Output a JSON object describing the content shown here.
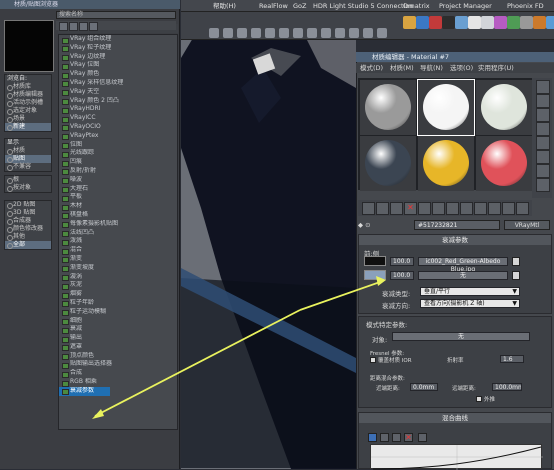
{
  "browser": {
    "title": "材质/贴图浏览器",
    "search_placeholder": "搜索名称",
    "maplist_header": "- 贴图",
    "groups": [
      {
        "title": "浏览自:",
        "items": [
          "材质库",
          "材质编辑器",
          "活动示例槽",
          "选定对象",
          "场景",
          "新建"
        ],
        "selected": 5
      },
      {
        "title": "显示",
        "items": [
          "材质",
          "贴图",
          "不兼容"
        ],
        "selected": 1
      },
      {
        "title": "",
        "items": [
          "根",
          "按对象"
        ],
        "selected": -1
      },
      {
        "title": "",
        "items": [
          "2D 贴图",
          "3D 贴图",
          "合成器",
          "颜色修改器",
          "其他",
          "全部"
        ],
        "selected": 5
      }
    ],
    "maps": [
      "VRay 组合纹理",
      "VRay 粒子纹理",
      "VRay 边纹理",
      "VRay 位图",
      "VRay 颜色",
      "VRay 采样信息纹理",
      "VRay 天空",
      "VRay 颜色 2 凹凸",
      "VRayHDRI",
      "VRayICC",
      "VRayOCIO",
      "VRayPtex",
      "位图",
      "光线跟踪",
      "凹痕",
      "反射/折射",
      "噪波",
      "大理石",
      "平板",
      "木材",
      "棋盘格",
      "每像素摄影机贴图",
      "法线凹凸",
      "泼溅",
      "混合",
      "渐变",
      "渐变坡度",
      "漩涡",
      "灰泥",
      "烟雾",
      "粒子年龄",
      "粒子运动模糊",
      "细胞",
      "衰减",
      "输出",
      "遮罩",
      "顶点颜色",
      "贴图输出选择器",
      "合成",
      "RGB 相乘",
      "衰减参数"
    ],
    "highlighted_map": 40
  },
  "menubar": {
    "items": [
      "帮助(H)",
      "RealFlow",
      "GoZ",
      "HDR Light Studio 5 Connection",
      "Ornatrix",
      "Project Manager",
      "Phoenix FD"
    ]
  },
  "material_editor": {
    "title": "材质编辑器 - Material #7",
    "menus": [
      "模式(D)",
      "材质(M)",
      "导航(N)",
      "选项(O)",
      "实用程序(U)"
    ],
    "slot_colors": [
      "#9a9a9a",
      "#f5f5f5",
      "#dfe5dc",
      "#3b4552",
      "#e7b628",
      "#e0525a"
    ],
    "material_name": "#517232821",
    "material_type": "VRayMtl",
    "falloff_params": {
      "header": "衰减参数",
      "section_label": "前:侧",
      "front_value": "100.0",
      "front_map": "ic002_Red_Green-Albedo Blue.jpg",
      "side_value": "100.0",
      "side_map": "无",
      "falloff_type_label": "衰减类型:",
      "falloff_type_value": "垂直/平行",
      "falloff_dir_label": "衰减方向:",
      "falloff_dir_value": "查看方向(摄影机 Z 轴)"
    },
    "mode_params": {
      "header": "模式特定参数:",
      "object_label": "对象:",
      "object_value": "无",
      "fresnel_label": "Fresnel 参数:",
      "override_label": "覆盖材质 IOR",
      "ior_label": "折射率",
      "ior_value": "1.6",
      "distance_label": "距离混合参数:",
      "near_label": "近端距离:",
      "near_value": "0.0mm",
      "far_label": "远端距离:",
      "far_value": "100.0mm",
      "extrapolate_label": "外推"
    },
    "curve_header": "混合曲线"
  }
}
